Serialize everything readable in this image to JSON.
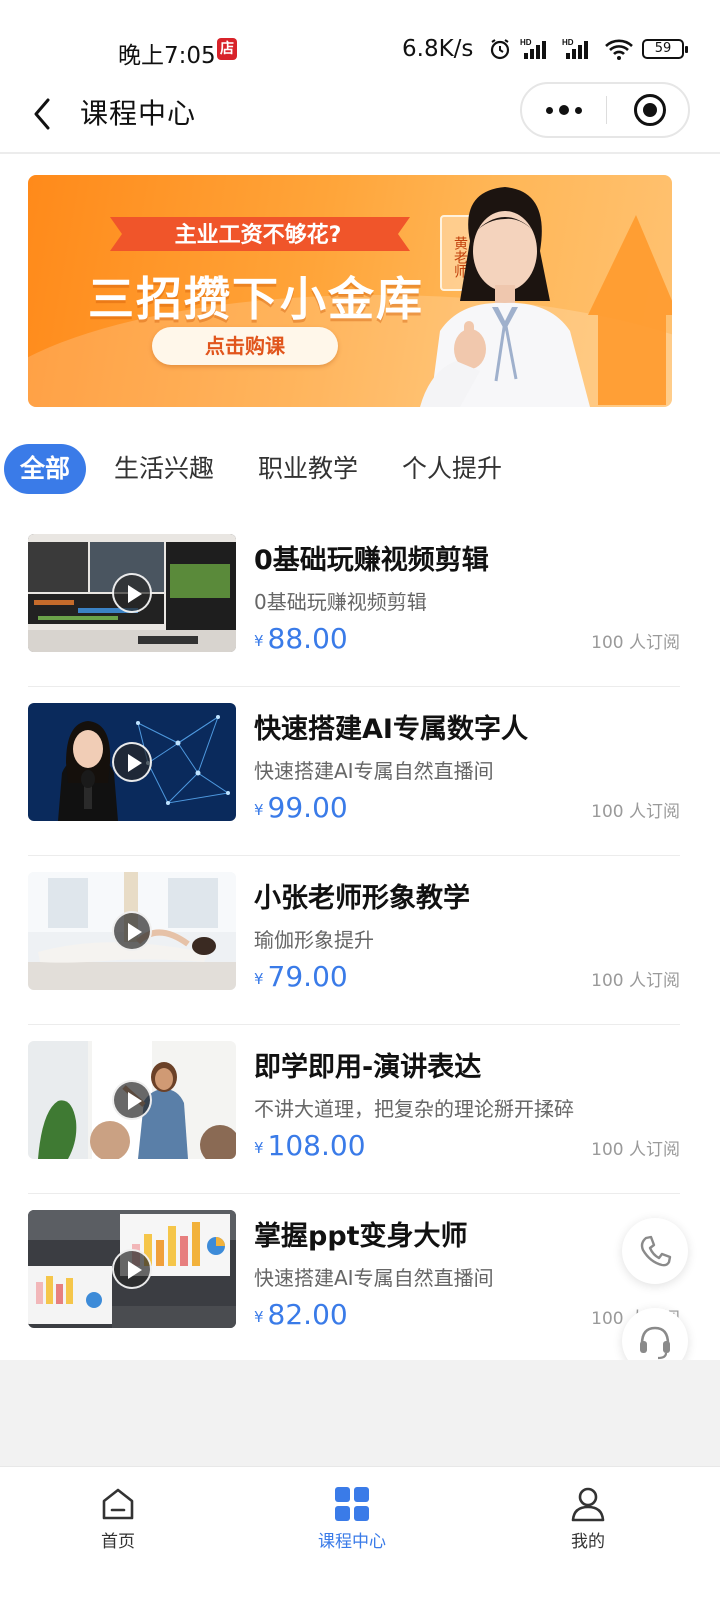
{
  "status_bar": {
    "time": "晚上7:05",
    "app_badge": "店",
    "speed": "6.8K/s",
    "battery": "59"
  },
  "nav": {
    "title": "课程中心"
  },
  "banner": {
    "subtitle": "主业工资不够花?",
    "title": "三招攒下小金库",
    "cta": "点击购课",
    "teacher_tag": "黄老师"
  },
  "tabs": [
    {
      "label": "全部",
      "active": true
    },
    {
      "label": "生活兴趣",
      "active": false
    },
    {
      "label": "职业教学",
      "active": false
    },
    {
      "label": "个人提升",
      "active": false
    }
  ],
  "courses": [
    {
      "title": "0基础玩赚视频剪辑",
      "desc": "0基础玩赚视频剪辑",
      "currency": "¥",
      "price": "88.00",
      "subscribers": "100 人订阅"
    },
    {
      "title": "快速搭建AI专属数字人",
      "desc": "快速搭建AI专属自然直播间",
      "currency": "¥",
      "price": "99.00",
      "subscribers": "100 人订阅"
    },
    {
      "title": "小张老师形象教学",
      "desc": "瑜伽形象提升",
      "currency": "¥",
      "price": "79.00",
      "subscribers": "100 人订阅"
    },
    {
      "title": "即学即用-演讲表达",
      "desc": "不讲大道理，把复杂的理论掰开揉碎",
      "currency": "¥",
      "price": "108.00",
      "subscribers": "100 人订阅"
    },
    {
      "title": "掌握ppt变身大师",
      "desc": "快速搭建AI专属自然直播间",
      "currency": "¥",
      "price": "82.00",
      "subscribers": "100 人订阅"
    }
  ],
  "tabbar": [
    {
      "label": "首页",
      "icon": "home-icon",
      "active": false
    },
    {
      "label": "课程中心",
      "icon": "grid-icon",
      "active": true
    },
    {
      "label": "我的",
      "icon": "user-icon",
      "active": false
    }
  ],
  "colors": {
    "accent": "#3a7be8",
    "banner_orange": "#ff8a1a"
  }
}
